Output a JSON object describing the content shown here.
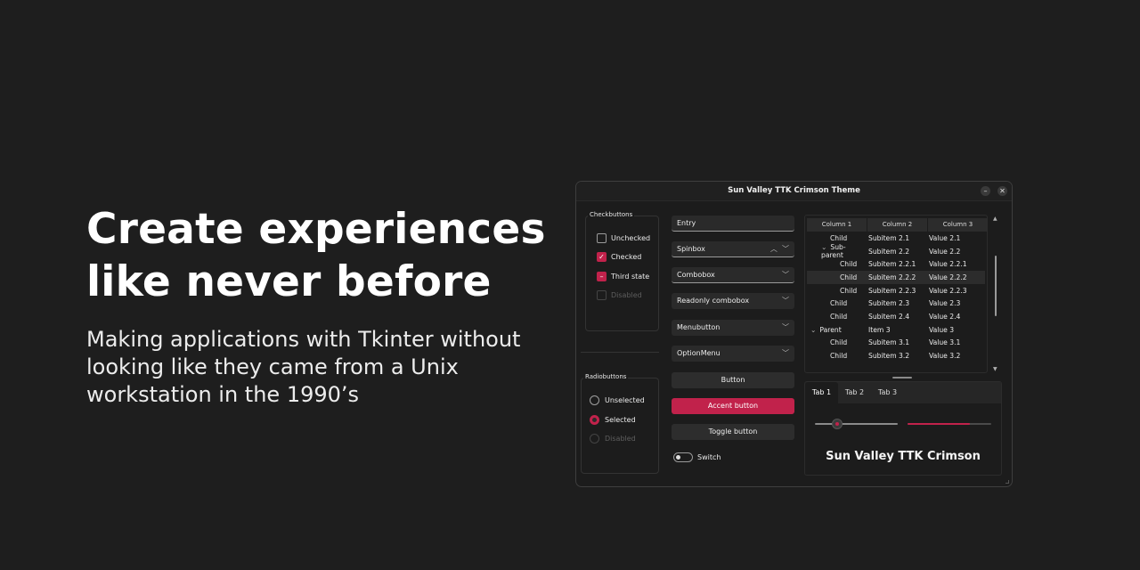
{
  "hero": {
    "title": "Create experiences like never before",
    "subtitle": "Making applications with Tkinter without looking like they came from a Unix workstation in the 1990’s"
  },
  "window": {
    "title": "Sun Valley TTK Crimson Theme",
    "min_glyph": "–",
    "close_glyph": "✕"
  },
  "checkbuttons": {
    "label": "Checkbuttons",
    "items": [
      {
        "label": "Unchecked",
        "state": "unchecked"
      },
      {
        "label": "Checked",
        "state": "checked"
      },
      {
        "label": "Third state",
        "state": "indeterminate"
      },
      {
        "label": "Disabled",
        "state": "disabled"
      }
    ]
  },
  "radiobuttons": {
    "label": "Radiobuttons",
    "items": [
      {
        "label": "Unselected",
        "state": "unselected"
      },
      {
        "label": "Selected",
        "state": "selected"
      },
      {
        "label": "Disabled",
        "state": "disabled"
      }
    ]
  },
  "widgets": {
    "entry_value": "Entry",
    "spinbox_value": "Spinbox",
    "combobox_value": "Combobox",
    "readonly_combobox_value": "Readonly combobox",
    "menubutton_label": "Menubutton",
    "optionmenu_label": "OptionMenu",
    "button_label": "Button",
    "accent_button_label": "Accent button",
    "toggle_button_label": "Toggle button",
    "switch_label": "Switch",
    "switch_on": false
  },
  "treeview": {
    "columns": [
      "Column 1",
      "Column 2",
      "Column 3"
    ],
    "rows": [
      {
        "c1": "Child",
        "c2": "Subitem 2.1",
        "c3": "Value 2.1",
        "level": 1,
        "expander": "",
        "selected": false
      },
      {
        "c1": "Sub-parent",
        "c2": "Subitem 2.2",
        "c3": "Value 2.2",
        "level": 1,
        "expander": "⌄",
        "selected": false
      },
      {
        "c1": "Child",
        "c2": "Subitem 2.2.1",
        "c3": "Value 2.2.1",
        "level": 2,
        "expander": "",
        "selected": false
      },
      {
        "c1": "Child",
        "c2": "Subitem 2.2.2",
        "c3": "Value 2.2.2",
        "level": 2,
        "expander": "",
        "selected": true
      },
      {
        "c1": "Child",
        "c2": "Subitem 2.2.3",
        "c3": "Value 2.2.3",
        "level": 2,
        "expander": "",
        "selected": false
      },
      {
        "c1": "Child",
        "c2": "Subitem 2.3",
        "c3": "Value 2.3",
        "level": 1,
        "expander": "",
        "selected": false
      },
      {
        "c1": "Child",
        "c2": "Subitem 2.4",
        "c3": "Value 2.4",
        "level": 1,
        "expander": "",
        "selected": false
      },
      {
        "c1": "Parent",
        "c2": "Item 3",
        "c3": "Value 3",
        "level": 0,
        "expander": "⌄",
        "selected": false
      },
      {
        "c1": "Child",
        "c2": "Subitem 3.1",
        "c3": "Value 3.1",
        "level": 1,
        "expander": "",
        "selected": false
      },
      {
        "c1": "Child",
        "c2": "Subitem 3.2",
        "c3": "Value 3.2",
        "level": 1,
        "expander": "",
        "selected": false
      }
    ]
  },
  "notebook": {
    "tabs": [
      "Tab 1",
      "Tab 2",
      "Tab 3"
    ],
    "active_tab": 0,
    "scale_value": 0.27,
    "progress_value": 0.74,
    "label": "Sun Valley TTK Crimson"
  },
  "colors": {
    "accent": "#c1224b",
    "background": "#1e1e1e",
    "window_bg": "#1c1c1c"
  }
}
